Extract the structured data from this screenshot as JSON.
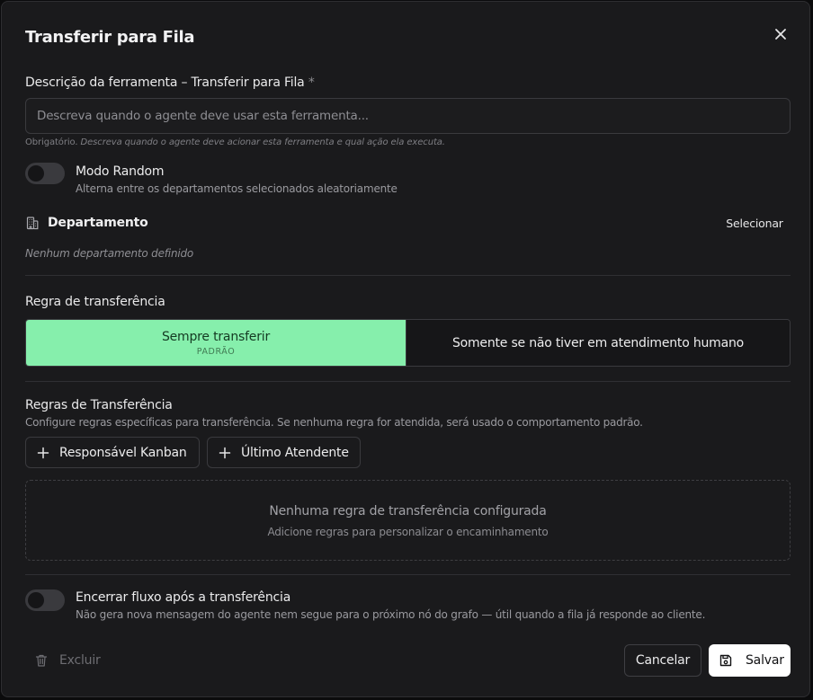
{
  "dialog": {
    "title": "Transferir para Fila"
  },
  "description_field": {
    "label": "Descrição da ferramenta – Transferir para Fila",
    "required_mark": "*",
    "value": "",
    "placeholder": "Descreva quando o agente deve usar esta ferramenta...",
    "hint_prefix": "Obrigatório.",
    "hint_text": "Descreva quando o agente deve acionar esta ferramenta e qual ação ela executa."
  },
  "random_mode": {
    "title": "Modo Random",
    "subtitle": "Alterna entre os departamentos selecionados aleatoriamente",
    "enabled": false
  },
  "department": {
    "title": "Departamento",
    "select_label": "Selecionar",
    "empty_text": "Nenhum departamento definido",
    "icon": "building-icon"
  },
  "transfer_rule": {
    "label": "Regra de transferência",
    "options": [
      {
        "label": "Sempre transferir",
        "badge": "PADRÃO",
        "selected": true
      },
      {
        "label": "Somente se não tiver em atendimento humano",
        "selected": false
      }
    ]
  },
  "transfer_rules": {
    "title": "Regras de Transferência",
    "description": "Configure regras específicas para transferência. Se nenhuma regra for atendida, será usado o comportamento padrão.",
    "add_buttons": [
      "Responsável Kanban",
      "Último Atendente"
    ],
    "empty_title": "Nenhuma regra de transferência configurada",
    "empty_subtitle": "Adicione regras para personalizar o encaminhamento"
  },
  "end_flow": {
    "title": "Encerrar fluxo após a transferência",
    "subtitle": "Não gera nova mensagem do agente nem segue para o próximo nó do grafo — útil quando a fila já responde ao cliente.",
    "enabled": false
  },
  "footer": {
    "delete_label": "Excluir",
    "cancel_label": "Cancelar",
    "save_label": "Salvar"
  },
  "colors": {
    "accent_selected": "#86efac",
    "background": "#1a1a1c",
    "primary_button": "#ffffff"
  }
}
